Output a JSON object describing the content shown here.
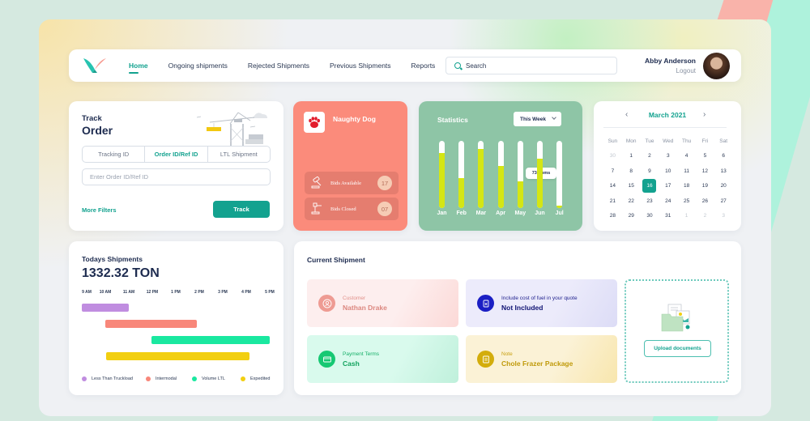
{
  "nav": {
    "links": [
      {
        "label": "Home",
        "active": true
      },
      {
        "label": "Ongoing shipments",
        "active": false
      },
      {
        "label": "Rejected Shipments",
        "active": false
      },
      {
        "label": "Previous Shipments",
        "active": false
      },
      {
        "label": "Reports",
        "active": false
      }
    ],
    "search_placeholder": "Search",
    "user_name": "Abby Anderson",
    "logout_label": "Logout"
  },
  "track": {
    "title_small": "Track",
    "title_big": "Order",
    "tabs": [
      {
        "label": "Tracking ID",
        "active": false
      },
      {
        "label": "Order ID/Ref ID",
        "active": true
      },
      {
        "label": "LTL Shipment",
        "active": false
      }
    ],
    "input_placeholder": "Enter Order ID/Ref ID",
    "input_value": "",
    "more_filters_label": "More Filters",
    "track_button_label": "Track"
  },
  "company": {
    "name": "Naughty Dog",
    "bids": [
      {
        "label": "Bids Available",
        "count": "17",
        "icon": "gavel-icon"
      },
      {
        "label": "Bids Closed",
        "count": "07",
        "icon": "gavel-closed-icon"
      }
    ]
  },
  "statistics": {
    "title": "Statistics",
    "period_selected": "This Week",
    "tooltip": "73 Spms"
  },
  "chart_data": {
    "type": "bar",
    "title": "Statistics",
    "categories": [
      "Jan",
      "Feb",
      "Mar",
      "Apr",
      "May",
      "Jun",
      "Jul"
    ],
    "values": [
      0.82,
      0.45,
      0.88,
      0.63,
      0.4,
      0.73,
      0.04
    ],
    "ylim": [
      0,
      1
    ],
    "highlight": {
      "category": "Jun",
      "label": "73 Spms"
    },
    "colors": {
      "fill": "#d4e614",
      "track": "#ffffff"
    }
  },
  "calendar": {
    "title": "March 2021",
    "weekdays": [
      "Sun",
      "Mon",
      "Tue",
      "Wed",
      "Thu",
      "Fri",
      "Sat"
    ],
    "days": [
      {
        "d": "30",
        "m": true
      },
      {
        "d": "1"
      },
      {
        "d": "2"
      },
      {
        "d": "3"
      },
      {
        "d": "4"
      },
      {
        "d": "5"
      },
      {
        "d": "6"
      },
      {
        "d": "7"
      },
      {
        "d": "8"
      },
      {
        "d": "9"
      },
      {
        "d": "10"
      },
      {
        "d": "11"
      },
      {
        "d": "12"
      },
      {
        "d": "13"
      },
      {
        "d": "14"
      },
      {
        "d": "15"
      },
      {
        "d": "16",
        "s": true
      },
      {
        "d": "17"
      },
      {
        "d": "18"
      },
      {
        "d": "19"
      },
      {
        "d": "20"
      },
      {
        "d": "21"
      },
      {
        "d": "22"
      },
      {
        "d": "23"
      },
      {
        "d": "24"
      },
      {
        "d": "25"
      },
      {
        "d": "26"
      },
      {
        "d": "27"
      },
      {
        "d": "28"
      },
      {
        "d": "29"
      },
      {
        "d": "30"
      },
      {
        "d": "31"
      },
      {
        "d": "1",
        "m": true
      },
      {
        "d": "2",
        "m": true
      },
      {
        "d": "3",
        "m": true
      }
    ]
  },
  "today": {
    "title": "Todays Shipments",
    "value": "1332.32 TON",
    "times": [
      "9 AM",
      "10 AM",
      "11 AM",
      "12 PM",
      "1 PM",
      "2 PM",
      "3 PM",
      "4 PM",
      "5 PM"
    ],
    "shipments": [
      {
        "name": "Less Than Truckload",
        "start": 9.0,
        "end": 11.0,
        "color": "#c08de0"
      },
      {
        "name": "Intermodal",
        "start": 10.0,
        "end": 13.9,
        "color": "#f8877a"
      },
      {
        "name": "Volume LTL",
        "start": 11.95,
        "end": 17.0,
        "color": "#1ae8a0"
      },
      {
        "name": "Expedited",
        "start": 10.05,
        "end": 16.15,
        "color": "#f2cf11"
      }
    ]
  },
  "current": {
    "title": "Current Shipment",
    "items": [
      {
        "label": "Customer",
        "value": "Nathan Drake",
        "icon": "customer-icon"
      },
      {
        "label": "Include cost of fuel in your quote",
        "value": "Not Included",
        "icon": "fuel-icon"
      },
      {
        "label": "Payment Terms",
        "value": "Cash",
        "icon": "payment-card-icon"
      },
      {
        "label": "Note",
        "value": "Chole Frazer Package",
        "icon": "note-icon"
      }
    ],
    "upload_label": "Upload documents"
  }
}
